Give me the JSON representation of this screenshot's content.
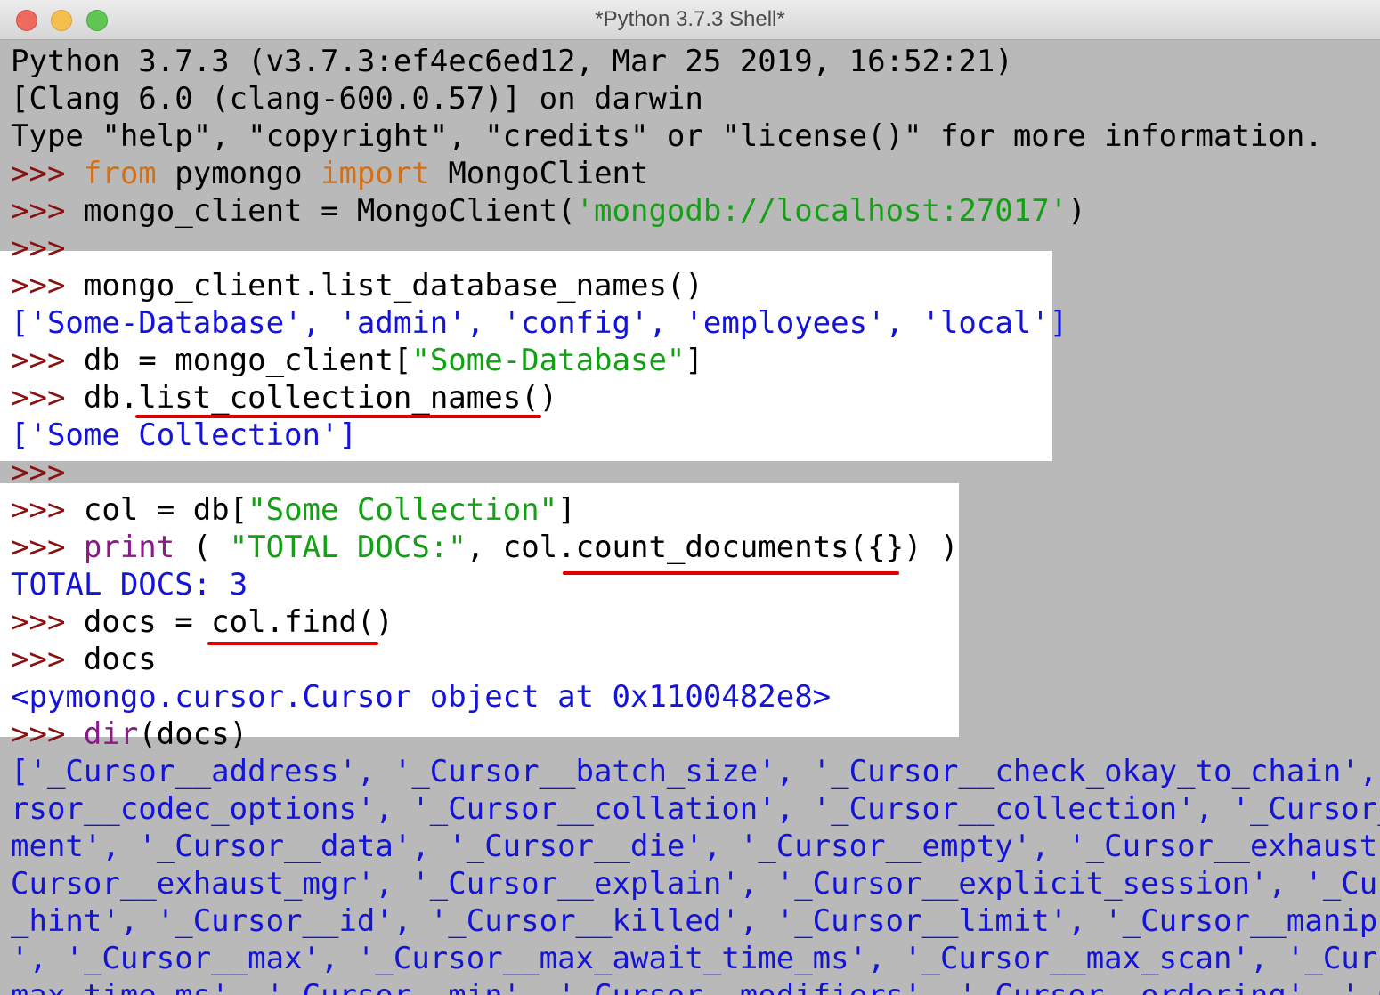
{
  "window": {
    "title": "*Python 3.7.3 Shell*",
    "buttons": [
      "close",
      "minimize",
      "maximize"
    ]
  },
  "shell": {
    "prompt": ">>> ",
    "banner": [
      "Python 3.7.3 (v3.7.3:ef4ec6ed12, Mar 25 2019, 16:52:21)",
      "[Clang 6.0 (clang-600.0.57)] on darwin",
      "Type \"help\", \"copyright\", \"credits\" or \"license()\" for more information."
    ],
    "l1": {
      "kw_from": "from",
      "mid": " pymongo ",
      "kw_import": "import",
      "tail": " MongoClient"
    },
    "l2": {
      "a": "mongo_client = MongoClient(",
      "str": "'mongodb://localhost:27017'",
      "b": ")"
    },
    "l3": {
      "code": "mongo_client.list_database_names()"
    },
    "l3_out": "['Some-Database', 'admin', 'config', 'employees', 'local']",
    "l4": {
      "a": "db = mongo_client[",
      "str": "\"Some-Database\"",
      "b": "]"
    },
    "l5": {
      "code": "db.list_collection_names()"
    },
    "l5_out": "['Some Collection']",
    "l6": {
      "a": "col = db[",
      "str": "\"Some Collection\"",
      "b": "]"
    },
    "l7": {
      "bi": "print",
      "a": " ( ",
      "str": "\"TOTAL DOCS:\"",
      "b": ", col.count_documents({}) )"
    },
    "l7_out": "TOTAL DOCS: 3",
    "l8": {
      "code": "docs = col.find()"
    },
    "l9": {
      "code": "docs"
    },
    "l9_out": "<pymongo.cursor.Cursor object at 0x1100482e8>",
    "l10": {
      "bi": "dir",
      "b": "(docs)"
    },
    "dir_out": [
      "['_Cursor__address', '_Cursor__batch_size', '_Cursor__check_okay_to_chain', '",
      "rsor__codec_options', '_Cursor__collation', '_Cursor__collection', '_Cursor__",
      "ment', '_Cursor__data', '_Cursor__die', '_Cursor__empty', '_Cursor__exhaust', '",
      "Cursor__exhaust_mgr', '_Cursor__explain', '_Cursor__explicit_session', '_Curs",
      "_hint', '_Cursor__id', '_Cursor__killed', '_Cursor__limit', '_Cursor__manipul",
      "', '_Cursor__max', '_Cursor__max_await_time_ms', '_Cursor__max_scan', '_Curso",
      "max_time_ms', '_Cursor__min', '_Cursor__modifiers', '_Cursor__ordering', '_Cu"
    ]
  },
  "annotations": {
    "underline_color": "#e00000",
    "underlined": [
      "list_collection_names()",
      "count_documents({})",
      "col.find()"
    ]
  }
}
